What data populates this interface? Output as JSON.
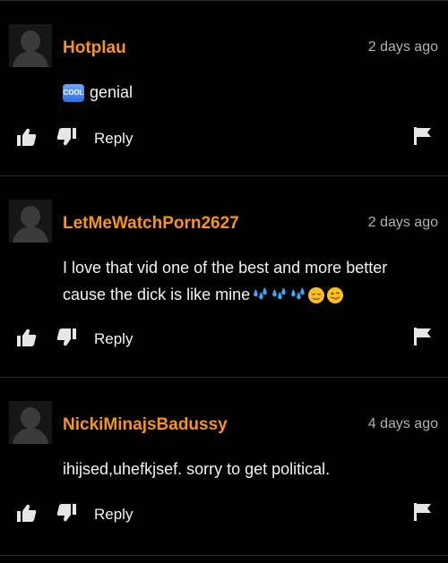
{
  "comments": [
    {
      "username": "Hotplau",
      "time": "2 days ago",
      "badge": "COOL",
      "text": "genial",
      "reply": "Reply"
    },
    {
      "username": "LetMeWatchPorn2627",
      "time": "2 days ago",
      "text_line1": "I love that vid one of the best and more better",
      "text_line2": "cause the dick is like mine",
      "emojis": [
        "sweat-droplets",
        "sweat-droplets",
        "sweat-droplets",
        "relieved-face",
        "winking-tongue-face"
      ],
      "reply": "Reply"
    },
    {
      "username": "NickiMinajsBadussy",
      "time": "4 days ago",
      "text": "ihijsed,uhefkjsef. sorry to get political.",
      "reply": "Reply"
    }
  ],
  "colors": {
    "username": "#f7941d",
    "background": "#000000",
    "text": "#f2f2f2",
    "timestamp": "#b0b0b0"
  }
}
